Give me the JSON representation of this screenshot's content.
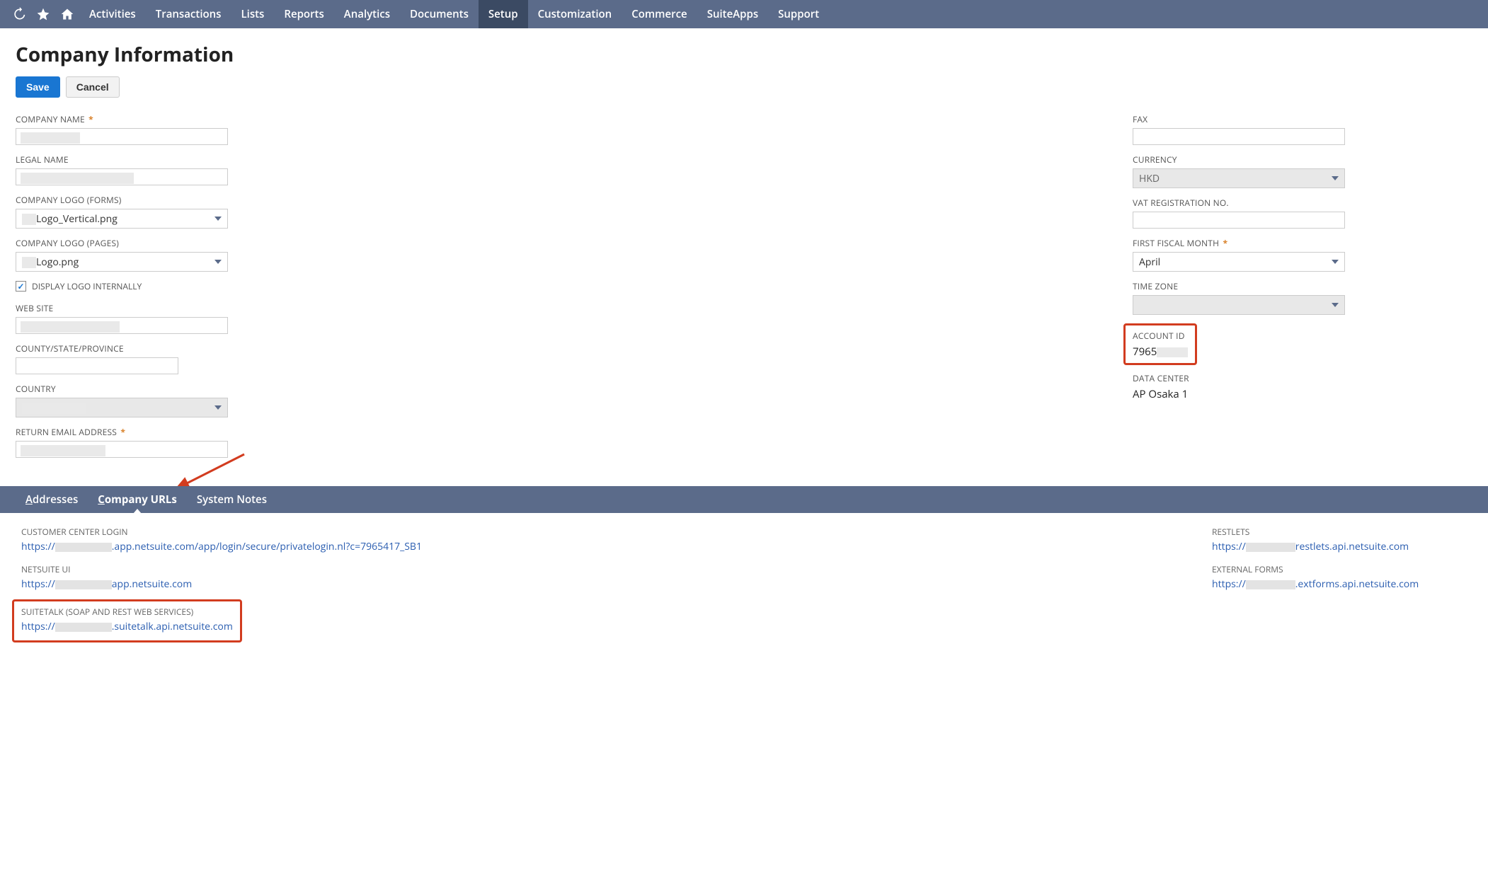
{
  "nav": {
    "items": [
      "Activities",
      "Transactions",
      "Lists",
      "Reports",
      "Analytics",
      "Documents",
      "Setup",
      "Customization",
      "Commerce",
      "SuiteApps",
      "Support"
    ],
    "active": "Setup"
  },
  "page": {
    "title": "Company Information",
    "save_label": "Save",
    "cancel_label": "Cancel"
  },
  "left": {
    "company_name_label": "COMPANY NAME",
    "legal_name_label": "LEGAL NAME",
    "logo_forms_label": "COMPANY LOGO (FORMS)",
    "logo_forms_value_suffix": "Logo_Vertical.png",
    "logo_pages_label": "COMPANY LOGO (PAGES)",
    "logo_pages_value_suffix": "Logo.png",
    "display_logo_label": "DISPLAY LOGO INTERNALLY",
    "website_label": "WEB SITE",
    "county_label": "COUNTY/STATE/PROVINCE",
    "country_label": "COUNTRY",
    "return_email_label": "RETURN EMAIL ADDRESS"
  },
  "right": {
    "fax_label": "FAX",
    "currency_label": "CURRENCY",
    "currency_value": "HKD",
    "vat_label": "VAT REGISTRATION NO.",
    "fiscal_month_label": "FIRST FISCAL MONTH",
    "fiscal_month_value": "April",
    "timezone_label": "TIME ZONE",
    "account_id_label": "ACCOUNT ID",
    "account_id_prefix": "7965",
    "data_center_label": "DATA CENTER",
    "data_center_value": "AP Osaka 1"
  },
  "tabs": {
    "addresses": "ddresses",
    "company_urls": "ompany URLs",
    "system_notes": "System Notes"
  },
  "urls": {
    "customer_center_label": "CUSTOMER CENTER LOGIN",
    "customer_center_prefix": "https://",
    "customer_center_suffix": ".app.netsuite.com/app/login/secure/privatelogin.nl?c=7965417_SB1",
    "netsuite_ui_label": "NETSUITE UI",
    "netsuite_ui_prefix": "https://",
    "netsuite_ui_suffix": "app.netsuite.com",
    "suitetalk_label": "SUITETALK (SOAP AND REST WEB SERVICES)",
    "suitetalk_prefix": "https://",
    "suitetalk_suffix": ".suitetalk.api.netsuite.com",
    "restlets_label": "RESTLETS",
    "restlets_prefix": "https://",
    "restlets_suffix": "restlets.api.netsuite.com",
    "extforms_label": "EXTERNAL FORMS",
    "extforms_prefix": "https://",
    "extforms_suffix": ".extforms.api.netsuite.com"
  }
}
